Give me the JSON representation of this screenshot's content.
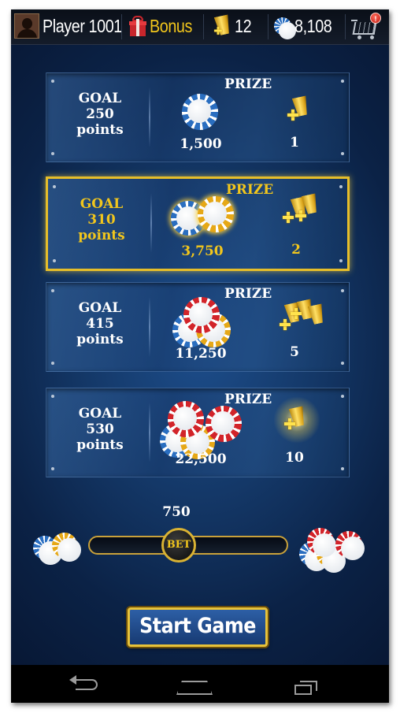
{
  "topbar": {
    "player_name": "Player 1001",
    "bonus_label": "Bonus",
    "cups_count": "12",
    "chips_count": "8,108",
    "notification_badge": "!"
  },
  "goals": [
    {
      "goal_word": "GOAL",
      "points": "250",
      "points_word": "points",
      "prize_label": "PRIZE",
      "chips": "1,500",
      "cups": "1",
      "active": false
    },
    {
      "goal_word": "GOAL",
      "points": "310",
      "points_word": "points",
      "prize_label": "PRIZE",
      "chips": "3,750",
      "cups": "2",
      "active": true
    },
    {
      "goal_word": "GOAL",
      "points": "415",
      "points_word": "points",
      "prize_label": "PRIZE",
      "chips": "11,250",
      "cups": "5",
      "active": false
    },
    {
      "goal_word": "GOAL",
      "points": "530",
      "points_word": "points",
      "prize_label": "PRIZE",
      "chips": "22,500",
      "cups": "10",
      "active": false
    }
  ],
  "bet": {
    "value": "750",
    "knob_label": "BET",
    "level_fraction": 0.45
  },
  "start_button": "Start Game",
  "colors": {
    "accent_gold": "#f2c61c",
    "panel_blue": "#1d4e8c",
    "chip_red": "#d2242a",
    "chip_blue": "#2a6ec0"
  },
  "icons": [
    "avatar-icon",
    "gift-icon",
    "cup-icon",
    "chip-icon",
    "cart-icon",
    "back-icon",
    "home-icon",
    "recent-apps-icon"
  ]
}
